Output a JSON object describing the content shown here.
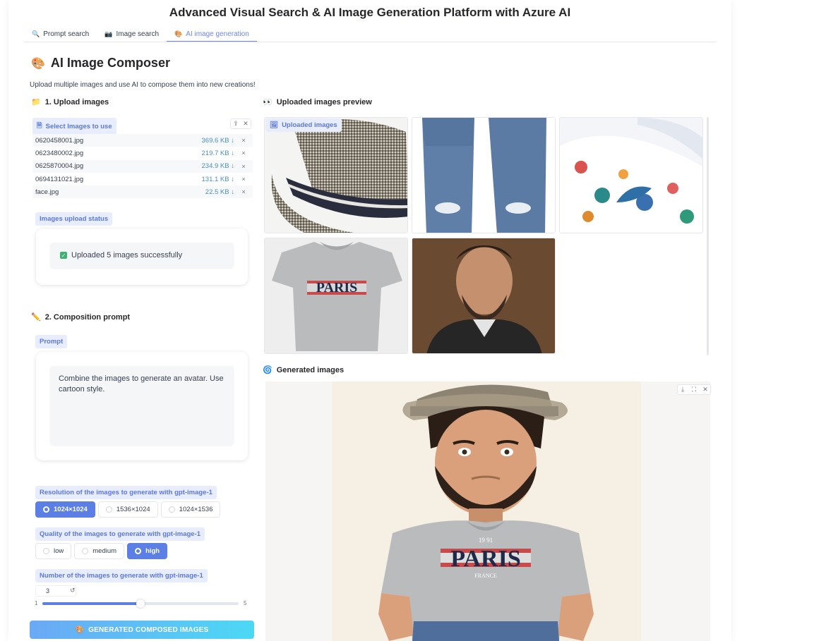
{
  "app": {
    "title": "Advanced Visual Search & AI Image Generation Platform with Azure AI"
  },
  "tabs": [
    {
      "label": "Prompt search",
      "icon": "magnifier-icon"
    },
    {
      "label": "Image search",
      "icon": "camera-icon"
    },
    {
      "label": "AI image generation",
      "icon": "palette-icon",
      "active": true
    }
  ],
  "composer": {
    "heading": "AI Image Composer",
    "subtitle": "Upload multiple images and use AI to compose them into new creations!"
  },
  "upload": {
    "section_title": "1. Upload images",
    "chip_label": "Select Images to use",
    "files": [
      {
        "name": "0620458001.jpg",
        "size": "369.6 KB ↓"
      },
      {
        "name": "0623480002.jpg",
        "size": "219.7 KB ↓"
      },
      {
        "name": "0625870004.jpg",
        "size": "234.9 KB ↓"
      },
      {
        "name": "0694131021.jpg",
        "size": "131.1 KB ↓"
      },
      {
        "name": "face.jpg",
        "size": "22.5 KB ↓"
      }
    ],
    "remove_glyph": "×"
  },
  "status": {
    "label": "Images upload status",
    "message": "Uploaded 5 images successfully"
  },
  "composition": {
    "section_title": "2. Composition prompt",
    "prompt_label": "Prompt",
    "prompt_text": "Combine the images to generate an avatar. Use cartoon style."
  },
  "resolution": {
    "label": "Resolution of the images to generate with gpt-image-1",
    "options": [
      "1024×1024",
      "1536×1024",
      "1024×1536"
    ],
    "selected": "1024×1024"
  },
  "quality": {
    "label": "Quality of the images to generate with gpt-image-1",
    "options": [
      "low",
      "medium",
      "high"
    ],
    "selected": "high"
  },
  "number": {
    "label": "Number of the images to generate with gpt-image-1",
    "value": "3",
    "min": "1",
    "max": "5",
    "reset_glyph": "↺"
  },
  "generate_button": {
    "label": "GENERATED COMPOSED IMAGES"
  },
  "preview": {
    "section_title": "Uploaded images preview",
    "chip_label": "Uploaded images",
    "items": [
      "hat-image",
      "jeans-image",
      "floral-shoes-image",
      "paris-tshirt-image",
      "portrait-image"
    ],
    "tshirt_text": "PARIS"
  },
  "generated": {
    "section_title": "Generated images",
    "tshirt_text": "PARIS",
    "tshirt_subtext": "FRANCE",
    "tshirt_year": "19  91"
  },
  "colors": {
    "accent": "#5b7fe4",
    "chip_bg": "#e8edfd",
    "button_gradient_start": "#6ba9f5",
    "button_gradient_end": "#4cd8f5",
    "filesize": "#4a8fc2"
  }
}
